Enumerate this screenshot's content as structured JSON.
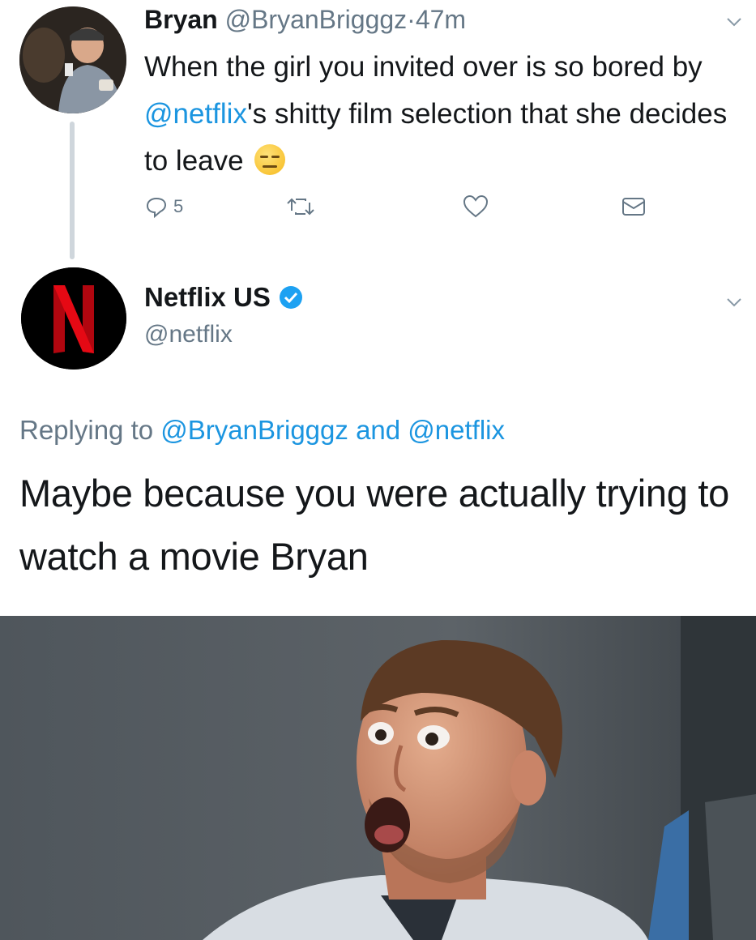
{
  "tweet1": {
    "name": "Bryan",
    "handle": "@BryanBrigggz",
    "separator": "·",
    "time": "47m",
    "text_1": "When the girl you invited over is so bored by ",
    "mention": "@netflix",
    "text_2": "'s shitty film selection that she decides to leave",
    "emoji": "expressionless-face",
    "reply_count": "5"
  },
  "tweet2": {
    "name": "Netflix US",
    "verified": true,
    "handle": "@netflix",
    "replying_prefix": "Replying to",
    "replying_user1": "@BryanBrigggz",
    "replying_and": "and",
    "replying_user2": "@netflix",
    "text": "Maybe because you were actually trying to watch a movie Bryan"
  },
  "colors": {
    "link": "#1b95e0",
    "muted": "#657786",
    "netflix_red": "#e50914"
  }
}
